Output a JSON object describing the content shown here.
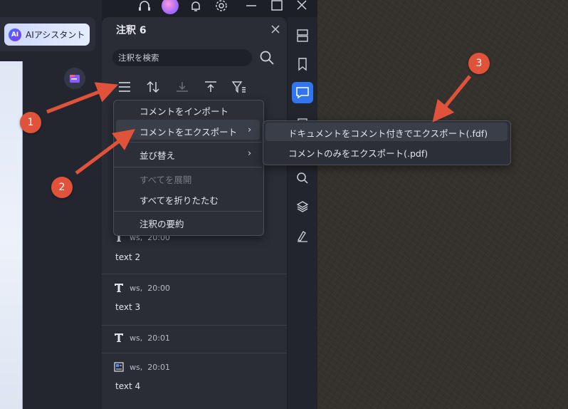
{
  "assistant_button": {
    "badge": "AI",
    "label": "AIアシスタント"
  },
  "annotations_panel": {
    "title": "注釈 6",
    "search_placeholder": "注釈を検索",
    "items": [
      {
        "icon": "text-tool-icon",
        "author": "ws",
        "time": "20:00",
        "text": "text 2"
      },
      {
        "icon": "text-tool-icon",
        "author": "ws",
        "time": "20:00",
        "text": "text 3"
      },
      {
        "icon": "text-tool-icon",
        "author": "ws",
        "time": "20:01",
        "text": ""
      },
      {
        "icon": "image-annotation-icon",
        "author": "ws",
        "time": "20:01",
        "text": "text 4"
      }
    ]
  },
  "menu": {
    "items": [
      {
        "label": "コメントをインポート",
        "disabled": false
      },
      {
        "label": "コメントをエクスポート",
        "disabled": false,
        "submenu": true,
        "highlighted": true
      },
      {
        "label": "並び替え",
        "disabled": false,
        "submenu": true
      },
      {
        "label": "すべてを展開",
        "disabled": true
      },
      {
        "label": "すべてを折りたたむ",
        "disabled": false
      },
      {
        "label": "注釈の要約",
        "disabled": false
      }
    ],
    "chevron": "›"
  },
  "submenu": {
    "items": [
      {
        "label": "ドキュメントをコメント付きでエクスポート(.fdf)",
        "highlighted": true
      },
      {
        "label": "コメントのみをエクスポート(.pdf)"
      }
    ]
  },
  "callouts": [
    "1",
    "2",
    "3"
  ],
  "colors": {
    "accent": "#2f76f0",
    "callout": "#e0533a",
    "panel": "#2a2d36"
  }
}
